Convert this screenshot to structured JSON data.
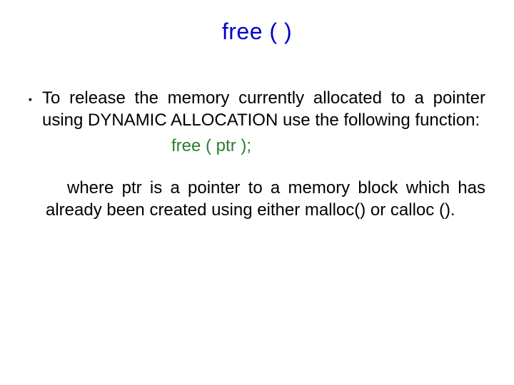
{
  "title": "free ( )",
  "bullet1": "To release the memory currently allocated to a pointer using DYNAMIC ALLOCATION use the following function:",
  "code": "free ( ptr );",
  "para2": "where ptr is a pointer to a memory block which has already been created using either malloc() or calloc ().",
  "marker": "▪"
}
